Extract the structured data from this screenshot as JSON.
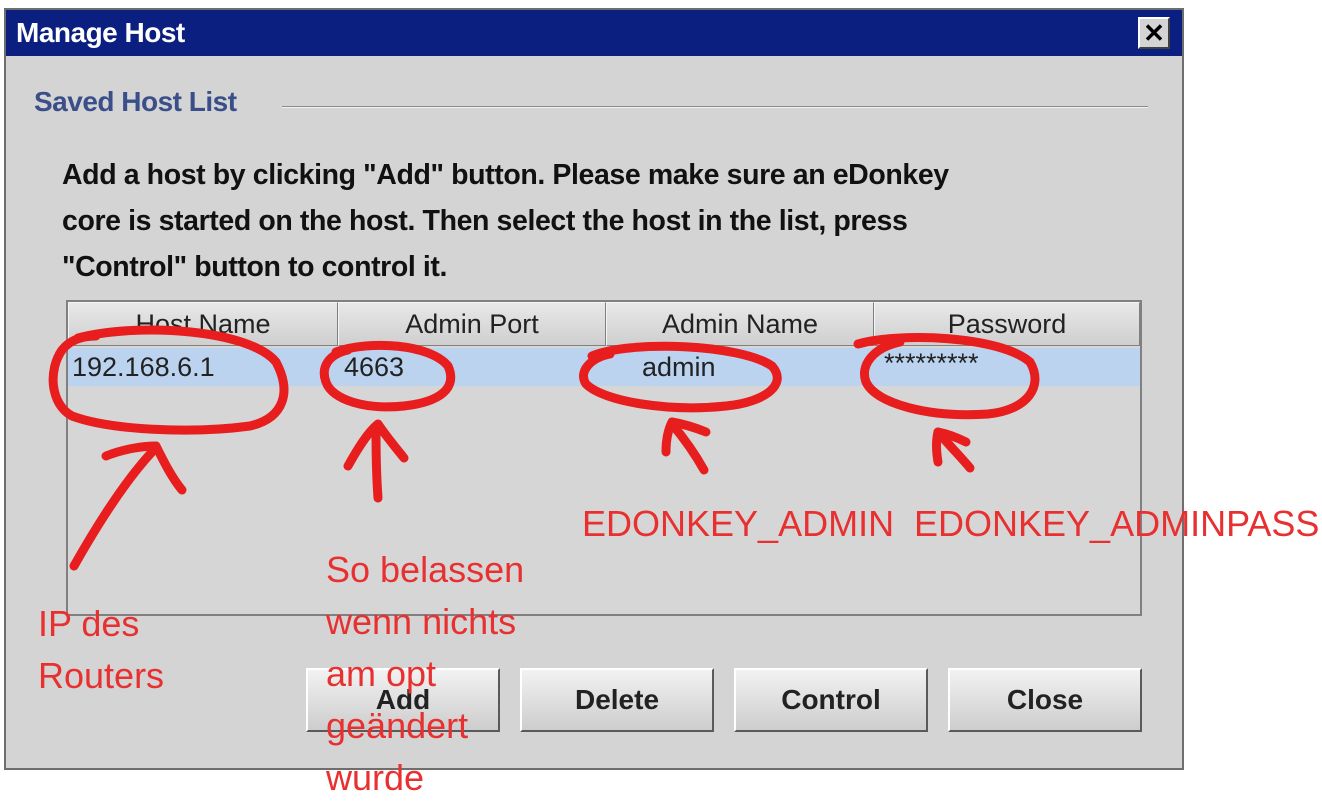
{
  "window": {
    "title": "Manage Host",
    "close_glyph": "✕"
  },
  "group": {
    "title": "Saved Host List"
  },
  "instructions": [
    "Add a host by clicking \"Add\" button. Please make sure an eDonkey",
    "core is started on the host. Then select the host in the list, press",
    "\"Control\" button to control it."
  ],
  "table": {
    "columns": [
      "Host Name",
      "Admin Port",
      "Admin Name",
      "Password"
    ],
    "rows": [
      {
        "host": "192.168.6.1",
        "port": "4663",
        "admin": "admin",
        "password": "*********"
      }
    ]
  },
  "buttons": {
    "add": "Add",
    "delete": "Delete",
    "control": "Control",
    "close": "Close"
  },
  "annotations": {
    "ip": [
      "IP des",
      "Routers"
    ],
    "port": [
      "So belassen",
      "wenn nichts",
      "am opt",
      "geändert",
      "wurde"
    ],
    "admin": "EDONKEY_ADMIN",
    "pass": "EDONKEY_ADMINPASS"
  },
  "colors": {
    "titlebar": "#0a1f80",
    "selection": "#bcd3f0",
    "annotation": "#e83030"
  }
}
